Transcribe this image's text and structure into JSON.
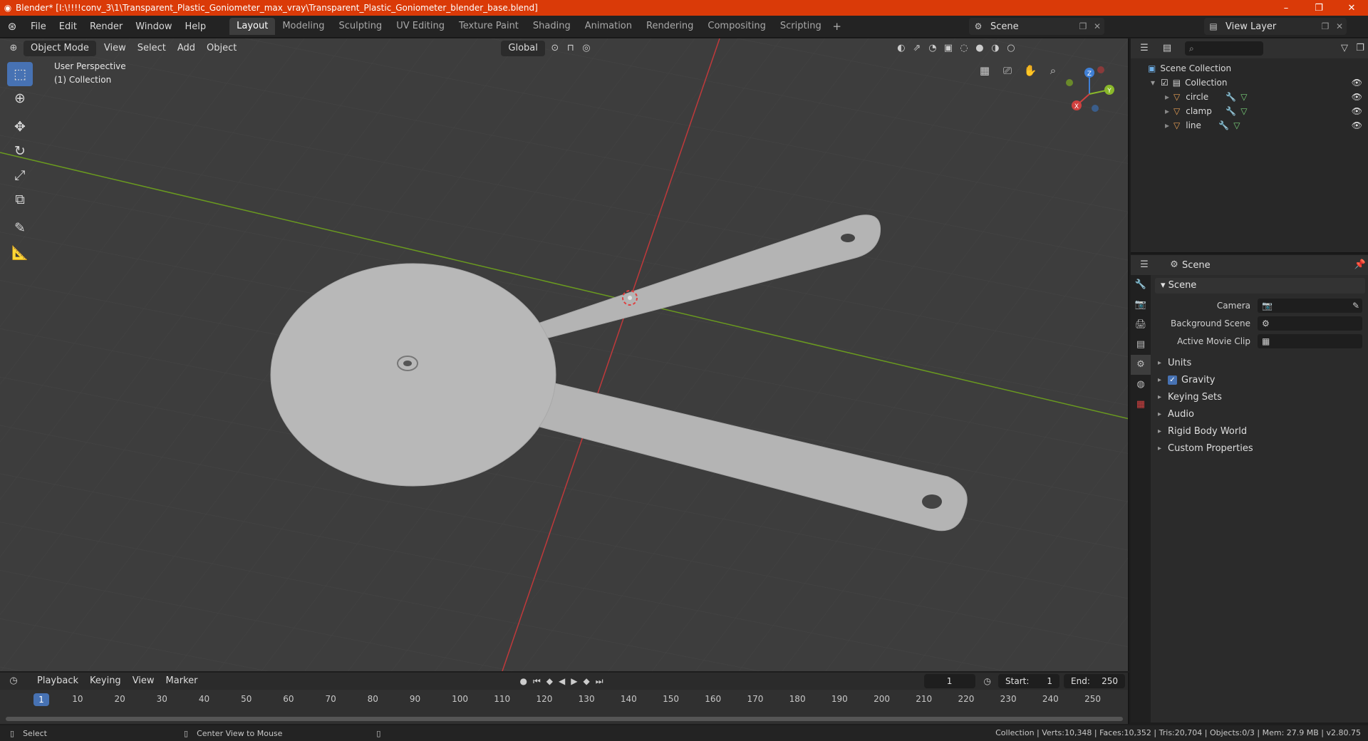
{
  "titlebar": {
    "title": "Blender* [I:\\!!!!conv_3\\1\\Transparent_Plastic_Goniometer_max_vray\\Transparent_Plastic_Goniometer_blender_base.blend]",
    "minimize": "–",
    "maximize": "❐",
    "close": "✕"
  },
  "menu": [
    "File",
    "Edit",
    "Render",
    "Window",
    "Help"
  ],
  "workspaces": [
    "Layout",
    "Modeling",
    "Sculpting",
    "UV Editing",
    "Texture Paint",
    "Shading",
    "Animation",
    "Rendering",
    "Compositing",
    "Scripting"
  ],
  "active_workspace": "Layout",
  "scene_name": "Scene",
  "view_layer": "View Layer",
  "viewport": {
    "mode": "Object Mode",
    "menus": [
      "View",
      "Select",
      "Add",
      "Object"
    ],
    "orientation": "Global",
    "perspective_label": "User Perspective",
    "collection_label": "(1) Collection",
    "gizmo": {
      "x": "X",
      "y": "Y",
      "z": "Z"
    }
  },
  "outliner": {
    "root": "Scene Collection",
    "collection": "Collection",
    "objects": [
      "circle",
      "clamp",
      "line"
    ]
  },
  "properties": {
    "header": "Scene",
    "panel": "Scene",
    "rows": [
      {
        "label": "Camera",
        "value": ""
      },
      {
        "label": "Background Scene",
        "value": ""
      },
      {
        "label": "Active Movie Clip",
        "value": ""
      }
    ],
    "subpanels": [
      "Units",
      "Gravity",
      "Keying Sets",
      "Audio",
      "Rigid Body World",
      "Custom Properties"
    ]
  },
  "timeline": {
    "menus": [
      "Playback",
      "Keying",
      "View",
      "Marker"
    ],
    "current_frame": "1",
    "start_label": "Start:",
    "start": "1",
    "end_label": "End:",
    "end": "250",
    "ticks": [
      "1",
      "10",
      "20",
      "30",
      "40",
      "50",
      "60",
      "70",
      "80",
      "90",
      "100",
      "110",
      "120",
      "130",
      "140",
      "150",
      "160",
      "170",
      "180",
      "190",
      "200",
      "210",
      "220",
      "230",
      "240",
      "250"
    ]
  },
  "statusbar": {
    "left": "Select",
    "middle": "Center View to Mouse",
    "right": "Collection | Verts:10,348 | Faces:10,352 | Tris:20,704 | Objects:0/3 | Mem: 27.9 MB | v2.80.75"
  },
  "colors": {
    "titlebar": "#da3a08",
    "accent": "#4772b3",
    "axis_x": "#c0393b",
    "axis_y": "#6a9a1f"
  }
}
